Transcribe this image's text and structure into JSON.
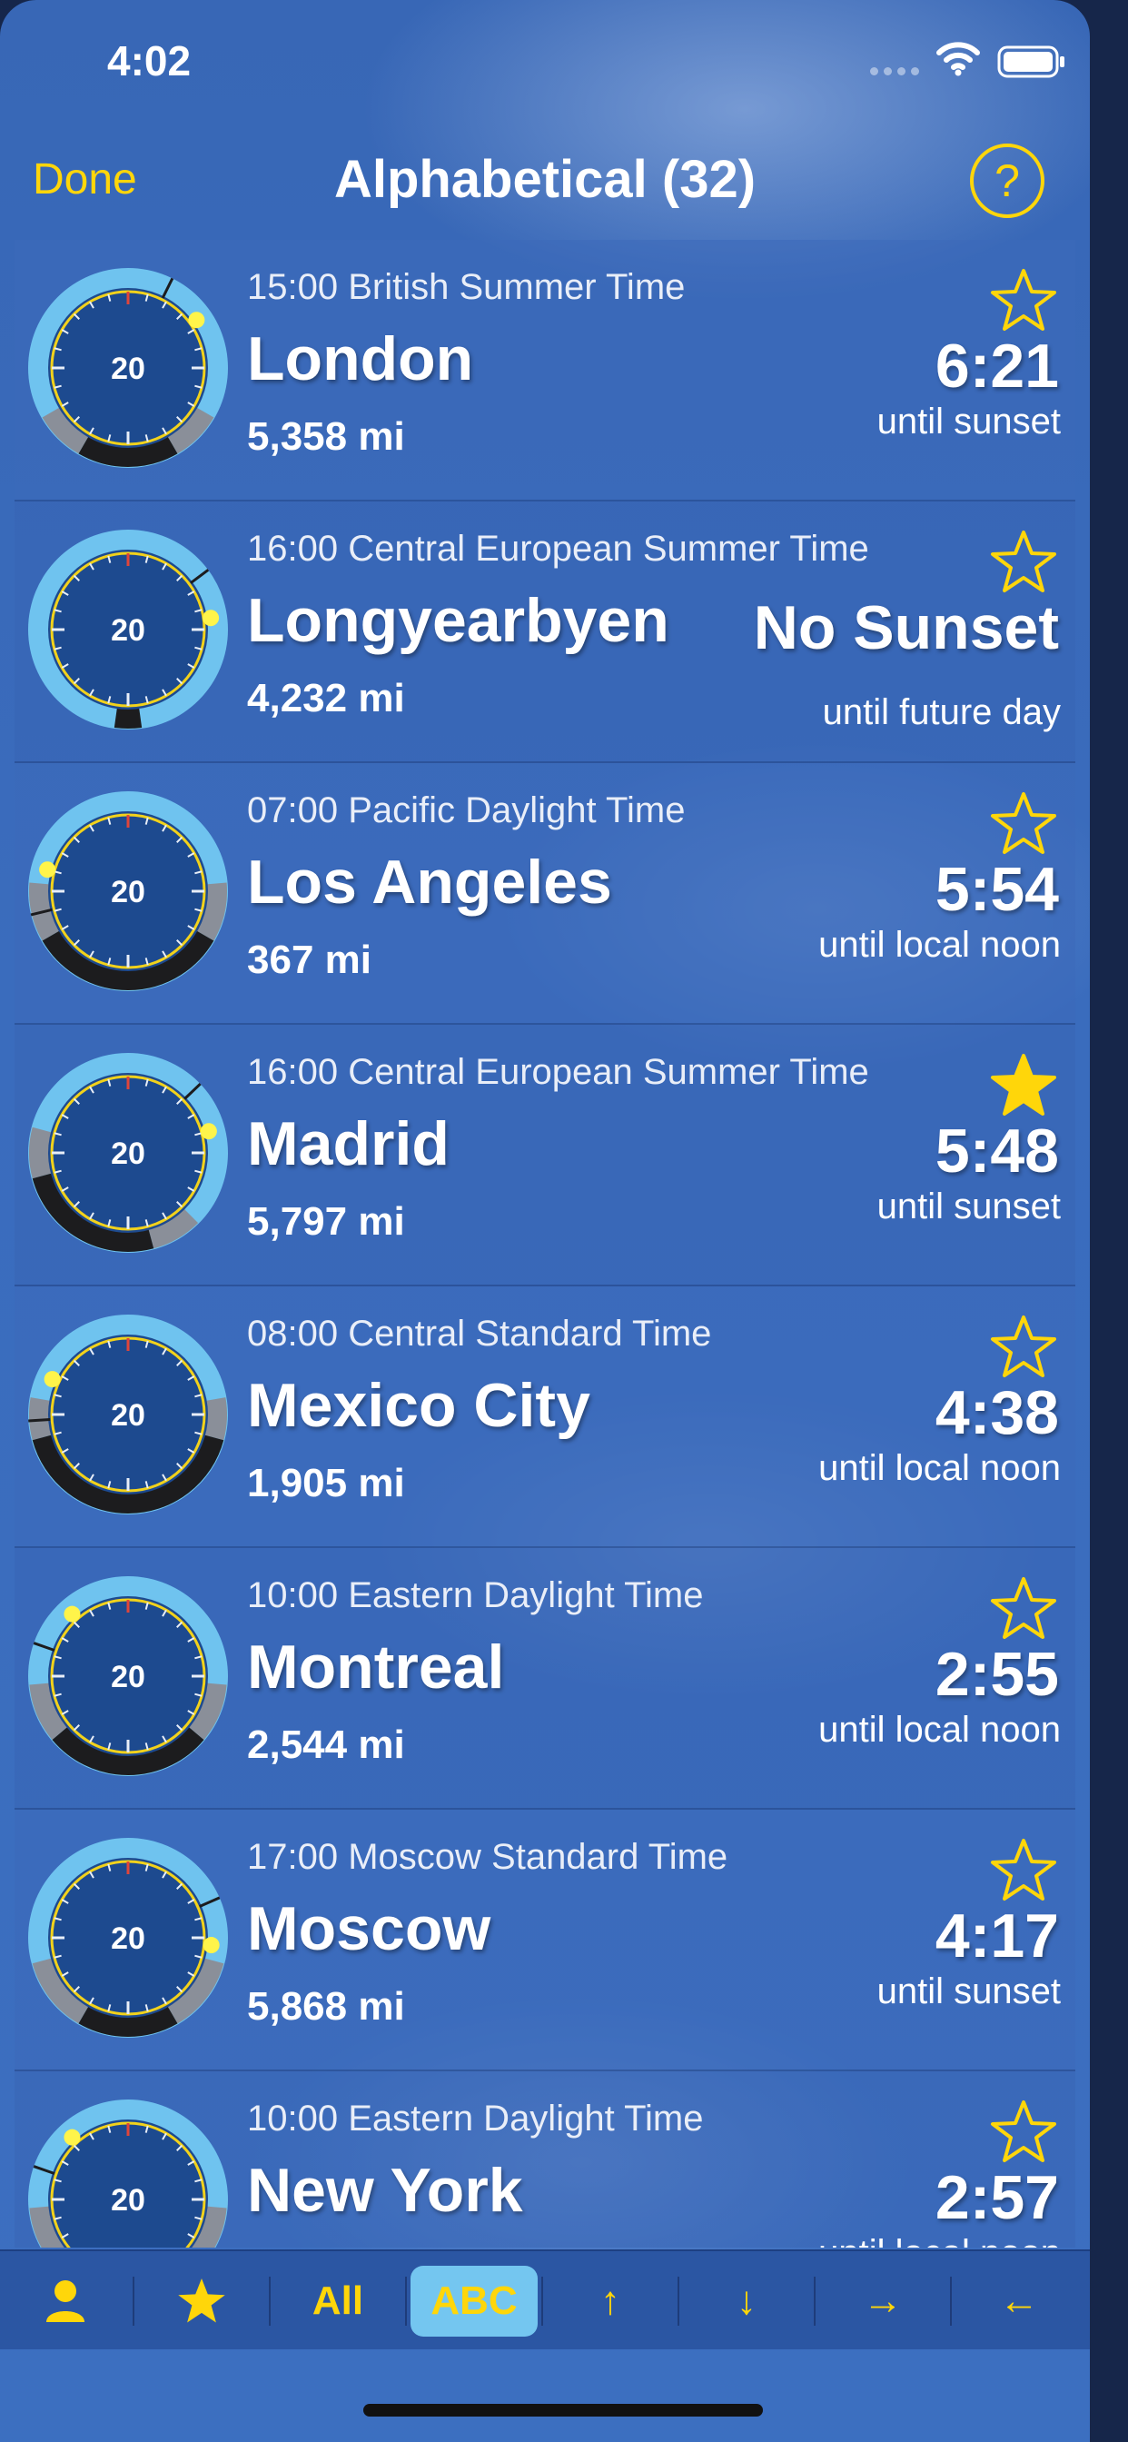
{
  "status_bar": {
    "time": "4:02"
  },
  "nav": {
    "done_label": "Done",
    "title": "Alphabetical (32)",
    "help_label": "?"
  },
  "colors": {
    "accent": "#ffd60a",
    "dial_ring": "#6fc3ef",
    "dial_face": "#1d4a8f"
  },
  "cities": [
    {
      "tz": "15:00 British Summer Time",
      "city": "London",
      "distance": "5,358 mi",
      "countdown": "6:21",
      "event": "until sunset",
      "favorite": false
    },
    {
      "tz": "16:00 Central European Summer Time",
      "city": "Longyearbyen",
      "distance": "4,232 mi",
      "countdown": "No Sunset",
      "event": "until future day",
      "favorite": false
    },
    {
      "tz": "07:00 Pacific Daylight Time",
      "city": "Los Angeles",
      "distance": "367 mi",
      "countdown": "5:54",
      "event": "until local noon",
      "favorite": false
    },
    {
      "tz": "16:00 Central European Summer Time",
      "city": "Madrid",
      "distance": "5,797 mi",
      "countdown": "5:48",
      "event": "until sunset",
      "favorite": true
    },
    {
      "tz": "08:00 Central Standard Time",
      "city": "Mexico City",
      "distance": "1,905 mi",
      "countdown": "4:38",
      "event": "until local noon",
      "favorite": false
    },
    {
      "tz": "10:00 Eastern Daylight Time",
      "city": "Montreal",
      "distance": "2,544 mi",
      "countdown": "2:55",
      "event": "until local noon",
      "favorite": false
    },
    {
      "tz": "17:00 Moscow Standard Time",
      "city": "Moscow",
      "distance": "5,868 mi",
      "countdown": "4:17",
      "event": "until sunset",
      "favorite": false
    },
    {
      "tz": "10:00 Eastern Daylight Time",
      "city": "New York",
      "distance": "",
      "countdown": "2:57",
      "event": "until local noon",
      "favorite": false
    }
  ],
  "dials": [
    {
      "label": "20",
      "sun_deg": 55,
      "night_start": 150,
      "night_end": 210,
      "twilight": 30
    },
    {
      "label": "20",
      "sun_deg": 82,
      "night_start": 172,
      "night_end": 188,
      "twilight": 0
    },
    {
      "label": "20",
      "sun_deg": 285,
      "night_start": 120,
      "night_end": 240,
      "twilight": 35
    },
    {
      "label": "20",
      "sun_deg": 75,
      "night_start": 165,
      "night_end": 255,
      "twilight": 30
    },
    {
      "label": "20",
      "sun_deg": 295,
      "night_start": 105,
      "night_end": 255,
      "twilight": 25
    },
    {
      "label": "20",
      "sun_deg": 318,
      "night_start": 130,
      "night_end": 230,
      "twilight": 35
    },
    {
      "label": "20",
      "sun_deg": 95,
      "night_start": 150,
      "night_end": 210,
      "twilight": 45
    },
    {
      "label": "20",
      "sun_deg": 318,
      "night_start": 130,
      "night_end": 230,
      "twilight": 35
    }
  ],
  "toolbar": {
    "items": [
      {
        "name": "person-filter-button",
        "label": "",
        "icon": "person-icon"
      },
      {
        "name": "favorites-filter-button",
        "label": "",
        "icon": "star-filled-icon"
      },
      {
        "name": "all-filter-button",
        "label": "All"
      },
      {
        "name": "abc-sort-button",
        "label": "ABC",
        "active": true
      },
      {
        "name": "sort-up-button",
        "label": "↑"
      },
      {
        "name": "sort-down-button",
        "label": "↓"
      },
      {
        "name": "sort-right-button",
        "label": "→"
      },
      {
        "name": "sort-left-button",
        "label": "←"
      }
    ]
  }
}
